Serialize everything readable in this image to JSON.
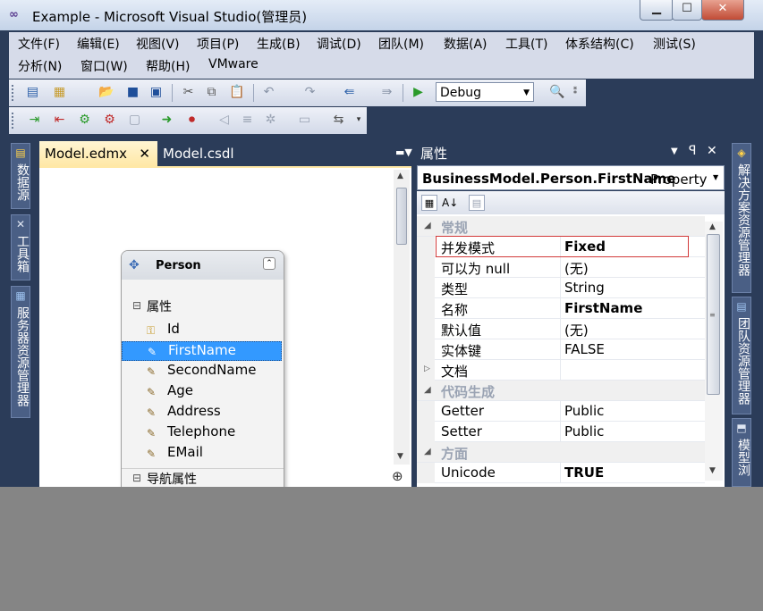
{
  "window": {
    "title": "Example - Microsoft Visual Studio(管理员)"
  },
  "menu": [
    [
      "文件(F)",
      "编辑(E)",
      "视图(V)",
      "项目(P)",
      "生成(B)",
      "调试(D)",
      "团队(M)",
      "数据(A)",
      "工具(T)",
      "体系结构(C)",
      "测试(S)"
    ],
    [
      "分析(N)",
      "窗口(W)",
      "帮助(H)",
      "VMware"
    ]
  ],
  "toolbar": {
    "config": "Debug"
  },
  "left_panels": [
    "数据源",
    "工具箱",
    "服务器资源管理器"
  ],
  "right_panels": [
    "解决方案资源管理器",
    "团队资源管理器",
    "模型浏"
  ],
  "doc_tabs": [
    {
      "label": "Model.edmx",
      "active": true
    },
    {
      "label": "Model.csdl",
      "active": false
    }
  ],
  "entity": {
    "title": "Person",
    "properties_section": "属性",
    "properties": [
      "Id",
      "FirstName",
      "SecondName",
      "Age",
      "Address",
      "Telephone",
      "EMail"
    ],
    "selected": "FirstName",
    "nav_section": "导航属性"
  },
  "properties_window": {
    "title": "属性",
    "object_name": "BusinessModel.Person.FirstName",
    "object_kind": "Property",
    "rows": [
      {
        "type": "cat",
        "name": "常规"
      },
      {
        "type": "prop",
        "name": "并发模式",
        "value": "Fixed",
        "bold": true
      },
      {
        "type": "prop",
        "name": "可以为 null",
        "value": "(无)",
        "bold": false
      },
      {
        "type": "prop",
        "name": "类型",
        "value": "String",
        "bold": false
      },
      {
        "type": "prop",
        "name": "名称",
        "value": "FirstName",
        "bold": true
      },
      {
        "type": "prop",
        "name": "默认值",
        "value": "(无)",
        "bold": false
      },
      {
        "type": "prop",
        "name": "实体键",
        "value": "FALSE",
        "bold": false
      },
      {
        "type": "prop",
        "name": "文档",
        "value": "",
        "bold": false,
        "collapsed": true
      },
      {
        "type": "cat",
        "name": "代码生成"
      },
      {
        "type": "prop",
        "name": "Getter",
        "value": "Public",
        "bold": false
      },
      {
        "type": "prop",
        "name": "Setter",
        "value": "Public",
        "bold": false
      },
      {
        "type": "cat",
        "name": "方面"
      },
      {
        "type": "prop",
        "name": "Unicode",
        "value": "TRUE",
        "bold": true
      }
    ]
  },
  "colors": {
    "highlight_border": "#d23a3a",
    "selection": "#3399ff",
    "chrome": "#2b3c59",
    "active_tab": "#ffe8a6"
  }
}
